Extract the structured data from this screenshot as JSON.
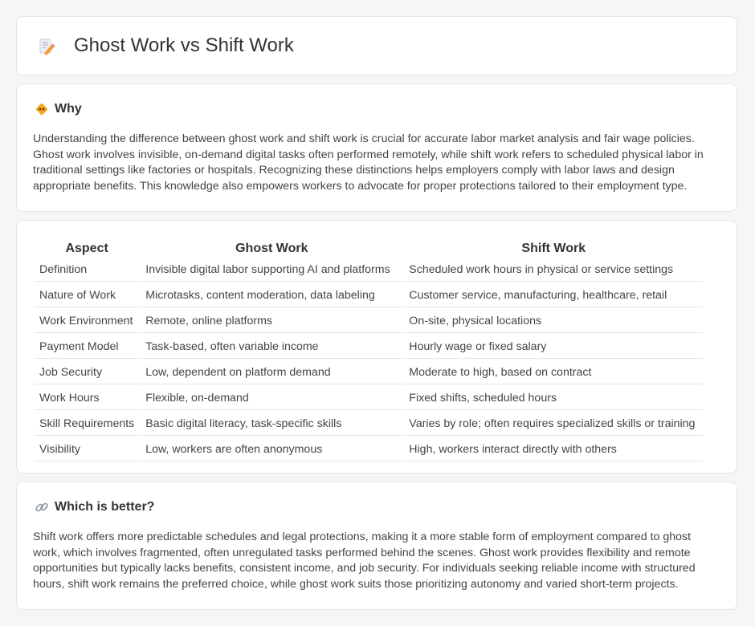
{
  "header": {
    "title": "Ghost Work vs Shift Work"
  },
  "why": {
    "heading": "Why",
    "text": "Understanding the difference between ghost work and shift work is crucial for accurate labor market analysis and fair wage policies. Ghost work involves invisible, on-demand digital tasks often performed remotely, while shift work refers to scheduled physical labor in traditional settings like factories or hospitals. Recognizing these distinctions helps employers comply with labor laws and design appropriate benefits. This knowledge also empowers workers to advocate for proper protections tailored to their employment type."
  },
  "table": {
    "headers": [
      "Aspect",
      "Ghost Work",
      "Shift Work"
    ],
    "rows": [
      [
        "Definition",
        "Invisible digital labor supporting AI and platforms",
        "Scheduled work hours in physical or service settings"
      ],
      [
        "Nature of Work",
        "Microtasks, content moderation, data labeling",
        "Customer service, manufacturing, healthcare, retail"
      ],
      [
        "Work Environment",
        "Remote, online platforms",
        "On-site, physical locations"
      ],
      [
        "Payment Model",
        "Task-based, often variable income",
        "Hourly wage or fixed salary"
      ],
      [
        "Job Security",
        "Low, dependent on platform demand",
        "Moderate to high, based on contract"
      ],
      [
        "Work Hours",
        "Flexible, on-demand",
        "Fixed shifts, scheduled hours"
      ],
      [
        "Skill Requirements",
        "Basic digital literacy, task-specific skills",
        "Varies by role; often requires specialized skills or training"
      ],
      [
        "Visibility",
        "Low, workers are often anonymous",
        "High, workers interact directly with others"
      ]
    ]
  },
  "better": {
    "heading": "Which is better?",
    "text": "Shift work offers more predictable schedules and legal protections, making it a more stable form of employment compared to ghost work, which involves fragmented, often unregulated tasks performed behind the scenes. Ghost work provides flexibility and remote opportunities but typically lacks benefits, consistent income, and job security. For individuals seeking reliable income with structured hours, shift work remains the preferred choice, while ghost work suits those prioritizing autonomy and varied short-term projects."
  },
  "icons": {
    "title": "document-pencil-icon",
    "why": "diamond-sign-icon",
    "better": "link-icon"
  },
  "colors": {
    "accent_orange": "#f39c3c",
    "accent_pink": "#e8728a",
    "background": "#f5f6f8"
  }
}
